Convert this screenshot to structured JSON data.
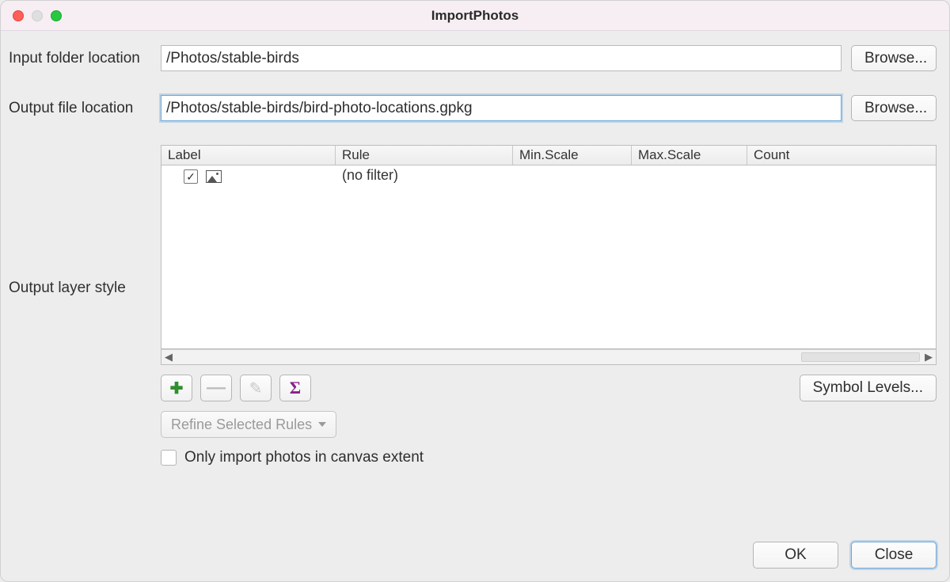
{
  "window": {
    "title": "ImportPhotos"
  },
  "inputFolder": {
    "label": "Input folder location",
    "value": "/Photos/stable-birds",
    "browseLabel": "Browse..."
  },
  "outputFile": {
    "label": "Output file location",
    "value": "/Photos/stable-birds/bird-photo-locations.gpkg",
    "browseLabel": "Browse..."
  },
  "layerStyle": {
    "label": "Output layer style",
    "columns": {
      "label": "Label",
      "rule": "Rule",
      "minScale": "Min.Scale",
      "maxScale": "Max.Scale",
      "count": "Count"
    },
    "rows": [
      {
        "checked": true,
        "ruleText": "(no filter)"
      }
    ],
    "symbolLevelsLabel": "Symbol Levels...",
    "refineLabel": "Refine Selected Rules",
    "canvasExtentLabel": "Only import photos in canvas extent",
    "canvasExtentChecked": false,
    "icons": {
      "add": "✚",
      "remove": "—",
      "edit": "✎",
      "sigma": "Σ",
      "check": "✓",
      "triLeft": "◀",
      "triRight": "▶"
    }
  },
  "footer": {
    "ok": "OK",
    "close": "Close"
  }
}
